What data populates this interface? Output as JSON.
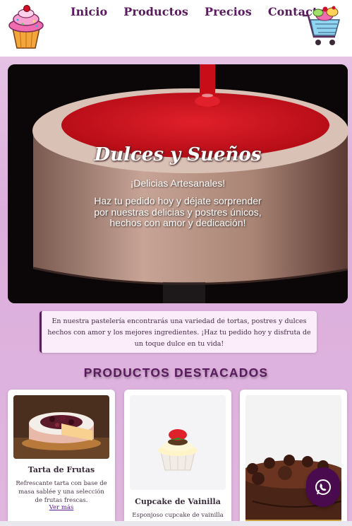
{
  "nav": {
    "items": [
      "Inicio",
      "Productos",
      "Precios",
      "Contacto"
    ]
  },
  "icons": {
    "logo": "cupcake-logo-icon",
    "cart": "shopping-cart-icon",
    "whatsapp": "whatsapp-icon"
  },
  "hero": {
    "title": "Dulces y Sueños",
    "subtitle": "¡Delicias Artesanales!",
    "text": "Haz tu pedido hoy y déjate sorprender por nuestras delicias y postres únicos, hechos con amor y dedicación!"
  },
  "intro": {
    "text": "En nuestra pastelería encontrarás una variedad de tortas, postres y dulces hechos con amor y los mejores ingredientes. ¡Haz tu pedido hoy y disfruta de un toque dulce en tu vida!"
  },
  "section": {
    "title": "PRODUCTOS DESTACADOS"
  },
  "products": [
    {
      "name": "Tarta de Frutas",
      "desc": "Refrescante tarta con base de masa sablée y una selección de frutas frescas.",
      "link": "Ver más"
    },
    {
      "name": "Cupcake de Vainilla",
      "desc": "Esponjoso cupcake de vainilla",
      "link": ""
    },
    {
      "name": "",
      "desc": "",
      "link": ""
    }
  ],
  "colors": {
    "brand": "#5a1a5e",
    "background": "#dcaedc",
    "glaze": "#c4101a"
  }
}
